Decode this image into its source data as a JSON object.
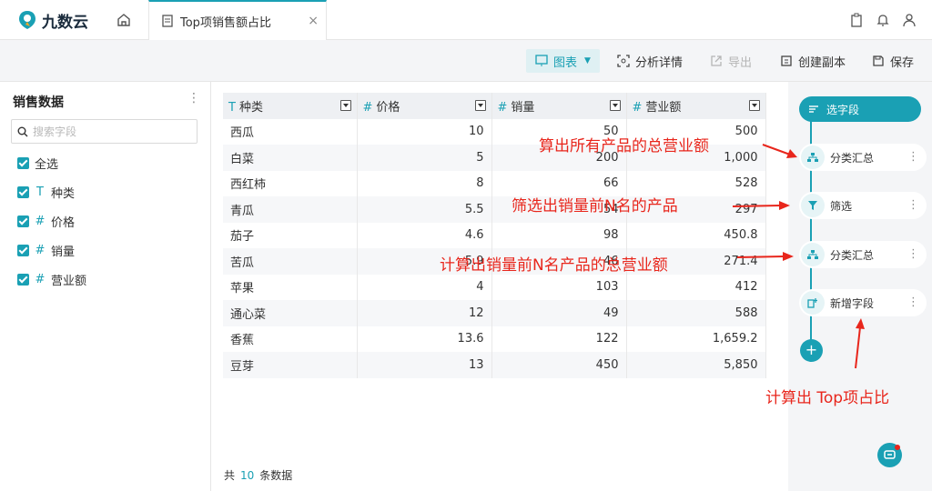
{
  "app": {
    "name": "九数云"
  },
  "tab": {
    "title": "Top项销售额占比",
    "close": "×"
  },
  "toolbar": {
    "chart": "图表",
    "analysis": "分析详情",
    "export": "导出",
    "copy": "创建副本",
    "save": "保存"
  },
  "left": {
    "title": "销售数据",
    "more": "⋮",
    "search_placeholder": "搜索字段",
    "fields": [
      {
        "label": "全选",
        "type": ""
      },
      {
        "label": "种类",
        "type": "T"
      },
      {
        "label": "价格",
        "type": "#"
      },
      {
        "label": "销量",
        "type": "#"
      },
      {
        "label": "营业额",
        "type": "#"
      }
    ]
  },
  "table": {
    "headers": [
      {
        "type": "T",
        "label": "种类"
      },
      {
        "type": "#",
        "label": "价格"
      },
      {
        "type": "#",
        "label": "销量"
      },
      {
        "type": "#",
        "label": "营业额"
      }
    ],
    "rows": [
      [
        "西瓜",
        "10",
        "50",
        "500"
      ],
      [
        "白菜",
        "5",
        "200",
        "1,000"
      ],
      [
        "西红柿",
        "8",
        "66",
        "528"
      ],
      [
        "青瓜",
        "5.5",
        "54",
        "297"
      ],
      [
        "茄子",
        "4.6",
        "98",
        "450.8"
      ],
      [
        "苦瓜",
        "5.9",
        "46",
        "271.4"
      ],
      [
        "苹果",
        "4",
        "103",
        "412"
      ],
      [
        "通心菜",
        "12",
        "49",
        "588"
      ],
      [
        "香蕉",
        "13.6",
        "122",
        "1,659.2"
      ],
      [
        "豆芽",
        "13",
        "450",
        "5,850"
      ]
    ]
  },
  "footer": {
    "prefix": "共",
    "count": "10",
    "suffix": "条数据"
  },
  "pipeline": {
    "head": "选字段",
    "steps": [
      "分类汇总",
      "筛选",
      "分类汇总",
      "新增字段"
    ],
    "add": "+"
  },
  "annotations": {
    "a1": "算出所有产品的总营业额",
    "a2": "筛选出销量前N名的产品",
    "a3": "计算出销量前N名产品的总营业额",
    "a4": "计算出 Top项占比"
  },
  "colors": {
    "accent": "#1aa0b4",
    "annotation": "#e8261c"
  }
}
